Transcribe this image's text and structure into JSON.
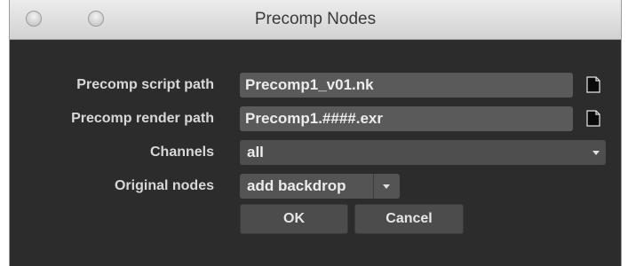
{
  "window": {
    "title": "Precomp Nodes"
  },
  "form": {
    "script_path_label": "Precomp script path",
    "script_path_value": "Precomp1_v01.nk",
    "render_path_label": "Precomp render path",
    "render_path_value": "Precomp1.####.exr",
    "channels_label": "Channels",
    "channels_value": "all",
    "original_nodes_label": "Original nodes",
    "original_nodes_value": "add backdrop"
  },
  "buttons": {
    "ok_label": "OK",
    "cancel_label": "Cancel"
  },
  "icons": {
    "file_browse": "file-icon",
    "dropdown": "chevron-down-icon"
  },
  "colors": {
    "dialog_bg": "#2c2c2c",
    "field_bg": "#5a5a5a",
    "label_text": "#d8d8d8"
  }
}
